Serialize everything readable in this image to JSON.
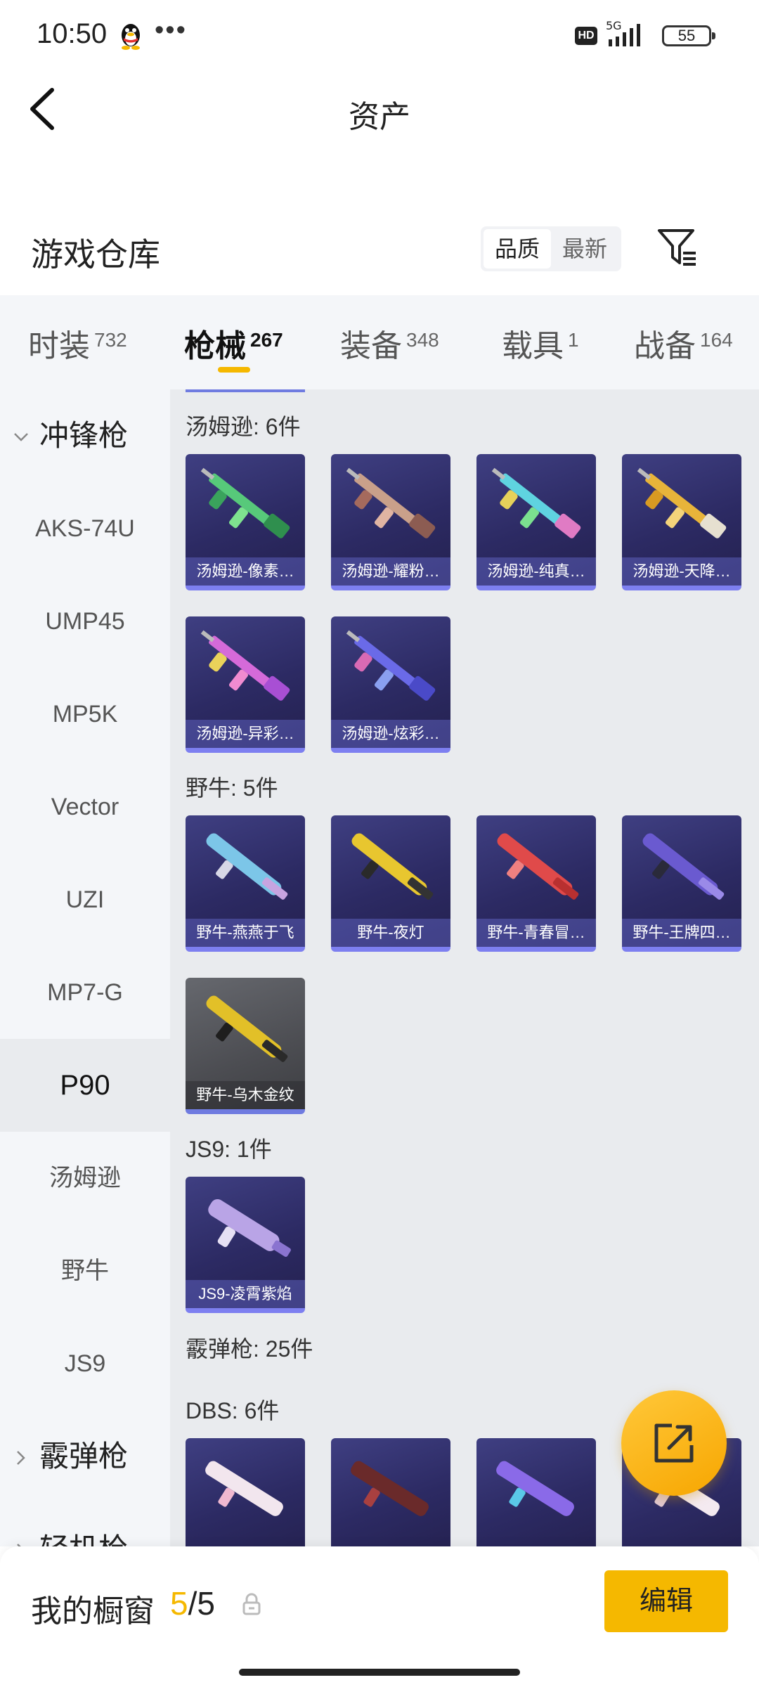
{
  "status_bar": {
    "time": "10:50",
    "dots": "•••",
    "hd": "HD",
    "network": "5G",
    "battery": "55"
  },
  "header": {
    "title": "资产",
    "back_icon": "chevron-left-icon"
  },
  "warehouse": {
    "title": "游戏仓库",
    "sort_options": [
      "品质",
      "最新"
    ],
    "sort_selected": "品质",
    "filter_icon": "filter-icon"
  },
  "tabs": [
    {
      "label": "时装",
      "count": "732"
    },
    {
      "label": "枪械",
      "count": "267",
      "active": true
    },
    {
      "label": "装备",
      "count": "348"
    },
    {
      "label": "载具",
      "count": "1"
    },
    {
      "label": "战备",
      "count": "164"
    }
  ],
  "sidebar": {
    "group_smg": "冲锋枪",
    "items": [
      "AKS-74U",
      "UMP45",
      "MP5K",
      "Vector",
      "UZI",
      "MP7-G",
      "P90",
      "汤姆逊",
      "野牛",
      "JS9"
    ],
    "active_item": "P90",
    "group_shotgun": "霰弹枪",
    "group_lmg": "轻机枪"
  },
  "content": {
    "groups": [
      {
        "label": "汤姆逊: 6件",
        "items": [
          "汤姆逊-像素…",
          "汤姆逊-耀粉…",
          "汤姆逊-纯真…",
          "汤姆逊-天降…",
          "汤姆逊-异彩…",
          "汤姆逊-炫彩…"
        ]
      },
      {
        "label": "野牛: 5件",
        "items": [
          "野牛-燕燕于飞",
          "野牛-夜灯",
          "野牛-青春冒…",
          "野牛-王牌四…",
          "野牛-乌木金纹"
        ]
      },
      {
        "label": "JS9: 1件",
        "items": [
          "JS9-凌霄紫焰"
        ]
      },
      {
        "label": "霰弹枪: 25件",
        "items": []
      },
      {
        "label": "DBS: 6件",
        "items": []
      }
    ]
  },
  "bottom": {
    "showcase_label": "我的橱窗",
    "current": "5",
    "total": "/5",
    "edit_label": "编辑"
  },
  "colors": {
    "accent": "#f5b800",
    "card_bg": "#2c2a63",
    "card_border": "#7d7ff0"
  }
}
